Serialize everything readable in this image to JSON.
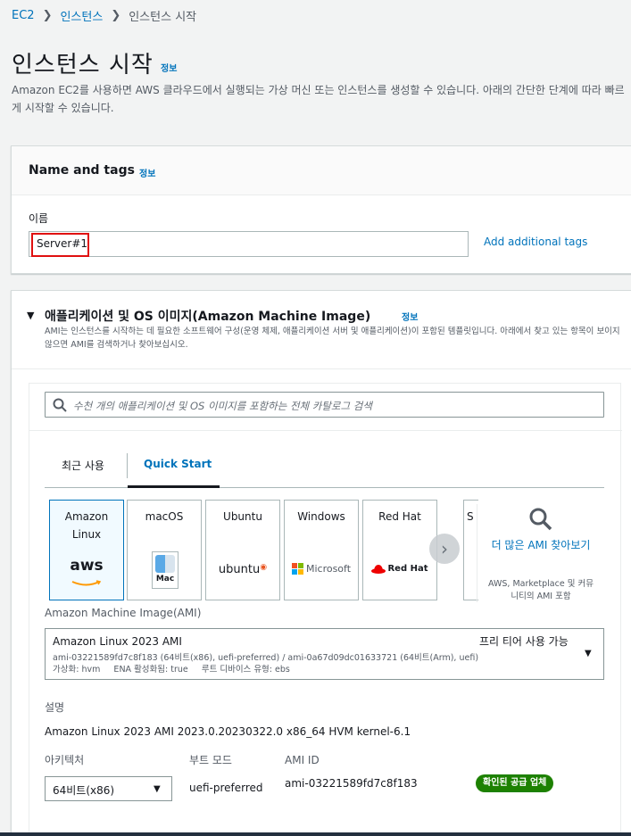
{
  "breadcrumb": {
    "items": [
      "EC2",
      "인스턴스"
    ],
    "current": "인스턴스 시작"
  },
  "page": {
    "title": "인스턴스 시작",
    "info": "정보",
    "description": "Amazon EC2를 사용하면 AWS 클라우드에서 실행되는 가상 머신 또는 인스턴스를 생성할 수 있습니다. 아래의 간단한 단계에 따라 빠르게 시작할 수 있습니다."
  },
  "name_tags": {
    "title": "Name and tags",
    "info": "정보",
    "name_label": "이름",
    "name_value": "Server#1",
    "add_tags": "Add additional tags"
  },
  "ami_section": {
    "title": "애플리케이션 및 OS 이미지(Amazon Machine Image)",
    "info": "정보",
    "description": "AMI는 인스턴스를 시작하는 데 필요한 소프트웨어 구성(운영 체제, 애플리케이션 서버 및 애플리케이션)이 포함된 템플릿입니다. 아래에서 찾고 있는 항목이 보이지 않으면 AMI를 검색하거나 찾아보십시오.",
    "search_placeholder": "수천 개의 애플리케이션 및 OS 이미지를 포함하는 전체 카탈로그 검색",
    "tabs": [
      "최근 사용",
      "Quick Start"
    ],
    "os_cards": [
      {
        "name": "Amazon Linux",
        "logo": "aws"
      },
      {
        "name": "macOS",
        "logo": "Mac"
      },
      {
        "name": "Ubuntu",
        "logo": "ubuntu"
      },
      {
        "name": "Windows",
        "logo": "Microsoft"
      },
      {
        "name": "Red Hat",
        "logo": "Red Hat"
      }
    ],
    "partial_card_letter": "S",
    "more_amis": "더 많은 AMI 찾아보기",
    "more_amis_sub": "AWS, Marketplace 및 커뮤니티의 AMI 포함",
    "ami_label": "Amazon Machine Image(AMI)",
    "ami_selected": {
      "name": "Amazon Linux 2023 AMI",
      "free_tier": "프리 티어 사용 가능",
      "ids": "ami-03221589fd7c8f183 (64비트(x86), uefi-preferred) / ami-0a67d09dc01633721 (64비트(Arm), uefi)",
      "attrs": "가상화: hvm     ENA 활성화됨: true     루트 디바이스 유형: ebs"
    },
    "desc_label": "설명",
    "desc_value": "Amazon Linux 2023 AMI 2023.0.20230322.0 x86_64 HVM kernel-6.1",
    "arch_label": "아키텍처",
    "arch_value": "64비트(x86)",
    "boot_label": "부트 모드",
    "boot_value": "uefi-preferred",
    "amiid_label": "AMI ID",
    "amiid_value": "ami-03221589fd7c8f183",
    "verified_badge": "확인된 공급 업체"
  },
  "colors": {
    "link": "#0073bb",
    "badge": "#1d8102",
    "highlight": "#e01010"
  }
}
